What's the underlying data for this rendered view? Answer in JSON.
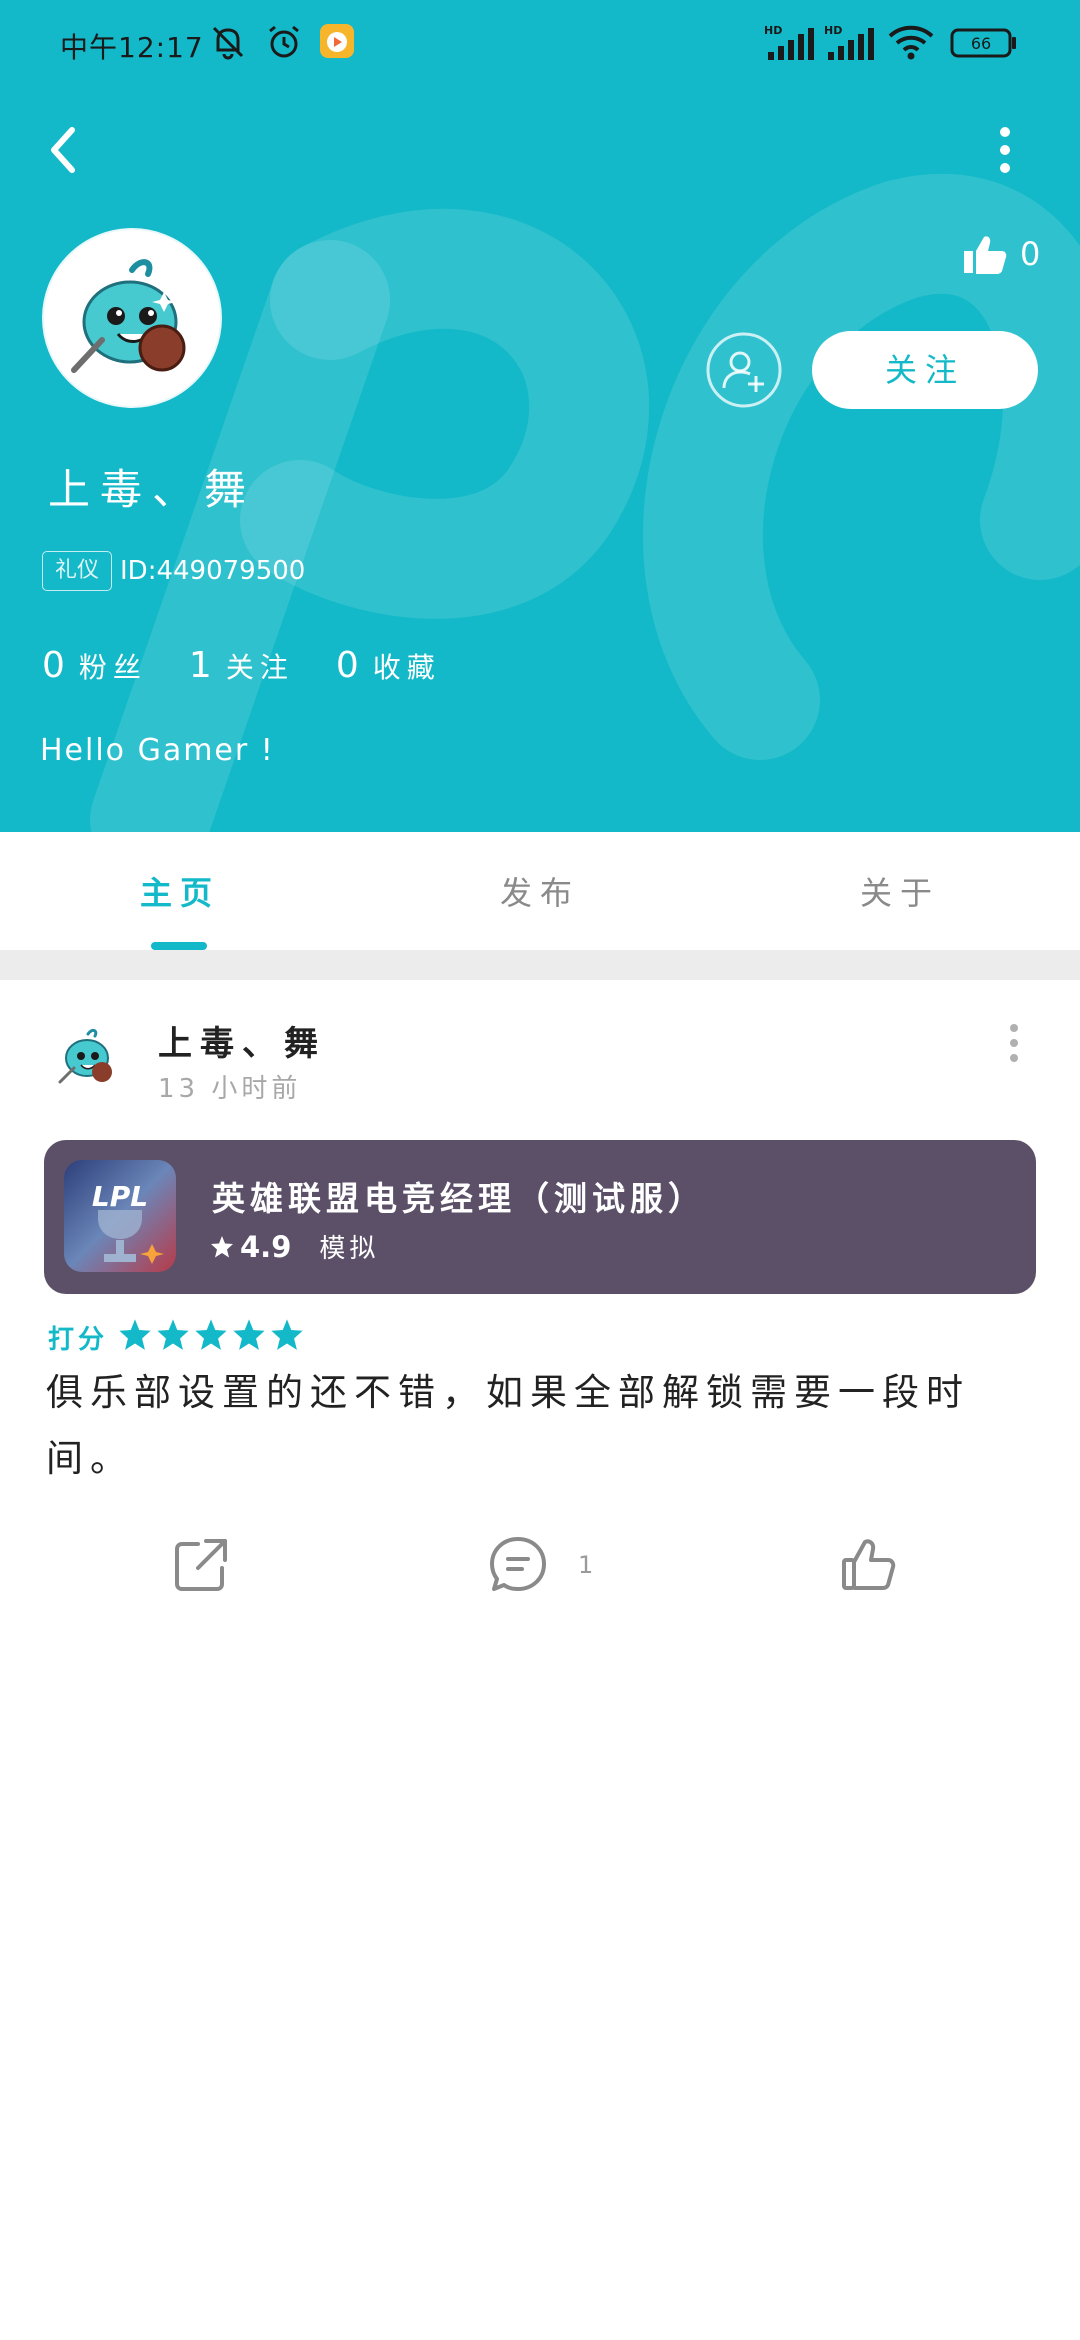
{
  "status_bar": {
    "time": "中午12:17",
    "battery": "66"
  },
  "profile": {
    "username": "上毒、舞",
    "tag": "礼仪",
    "id_text": "ID:449079500",
    "likes": "0",
    "follow_label": "关注",
    "stats": [
      {
        "value": "0",
        "label": "粉丝"
      },
      {
        "value": "1",
        "label": "关注"
      },
      {
        "value": "0",
        "label": "收藏"
      }
    ],
    "bio": "Hello Gamer !"
  },
  "tabs": [
    {
      "label": "主页",
      "active": true
    },
    {
      "label": "发布",
      "active": false
    },
    {
      "label": "关于",
      "active": false
    }
  ],
  "post": {
    "author": "上毒、舞",
    "time": "13 小时前",
    "game": {
      "title": "英雄联盟电竞经理（测试服）",
      "rating": "4.9",
      "genre": "模拟",
      "icon_text": "LPL"
    },
    "score_label": "打分",
    "stars": 5,
    "text": "俱乐部设置的还不错，如果全部解锁需要一段时间。",
    "comment_count": "1"
  },
  "colors": {
    "accent": "#13b9c8",
    "game_card_bg": "#5c5068",
    "divider": "#ececec"
  },
  "icons": {
    "back": "chevron-left-icon",
    "more": "more-vertical-icon",
    "like": "thumbs-up-icon",
    "add_friend": "add-user-icon",
    "share": "share-icon",
    "comment": "comment-icon",
    "star": "star-icon"
  }
}
